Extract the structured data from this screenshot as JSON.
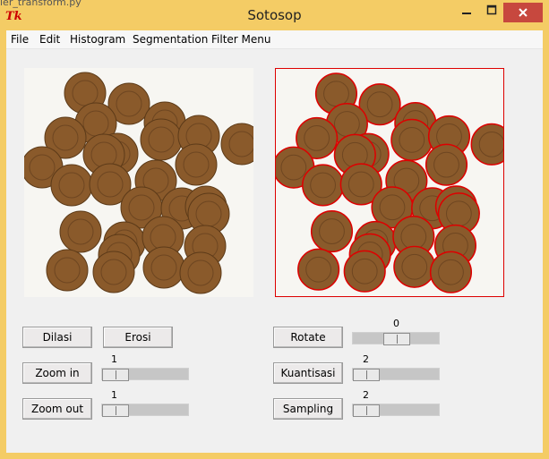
{
  "behind_window_text": "ier_transform.py",
  "window": {
    "title": "Sotosop",
    "logo_text": "Tk",
    "min_icon": "minimize-icon",
    "max_icon": "maximize-icon",
    "close_icon": "close-icon"
  },
  "menu": [
    "File",
    "Edit",
    "Histogram",
    "Segmentation",
    "Filter Menu"
  ],
  "images": {
    "left": {
      "name": "original-coins-image",
      "icon": "coins-image"
    },
    "right": {
      "name": "segmented-coins-image",
      "icon": "coins-image-red-outline",
      "outline_color": "#dd0000"
    }
  },
  "buttons": {
    "dilasi": "Dilasi",
    "erosi": "Erosi",
    "zoom_in": "Zoom in",
    "zoom_out": "Zoom out",
    "rotate": "Rotate",
    "kuantisasi": "Kuantisasi",
    "sampling": "Sampling"
  },
  "sliders": {
    "zoom_in": {
      "value": "1"
    },
    "zoom_out": {
      "value": "1"
    },
    "rotate": {
      "value": "0"
    },
    "kuantisasi": {
      "value": "2"
    },
    "sampling": {
      "value": "2"
    }
  },
  "colors": {
    "title_bar": "#f4cc65",
    "close_button": "#c7483e",
    "coin": "#8a5a2b",
    "segment_outline": "#dd0000"
  }
}
